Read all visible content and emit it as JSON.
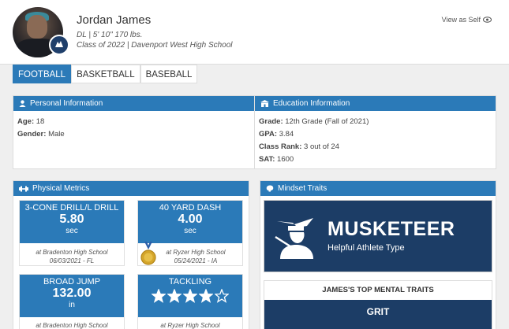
{
  "profile": {
    "name": "Jordan James",
    "position_line": "DL | 5' 10\" 170 lbs.",
    "class_line": "Class of 2022 | Davenport West High School",
    "view_as_self": "View as Self"
  },
  "tabs": [
    {
      "label": "FOOTBALL",
      "active": true
    },
    {
      "label": "BASKETBALL",
      "active": false
    },
    {
      "label": "BASEBALL",
      "active": false
    }
  ],
  "personal": {
    "title": "Personal Information",
    "age_label": "Age:",
    "age_value": "18",
    "gender_label": "Gender:",
    "gender_value": "Male"
  },
  "education": {
    "title": "Education Information",
    "grade_label": "Grade:",
    "grade_value": "12th Grade (Fall of 2021)",
    "gpa_label": "GPA:",
    "gpa_value": "3.84",
    "rank_label": "Class Rank:",
    "rank_value": "3 out of 24",
    "sat_label": "SAT:",
    "sat_value": "1600"
  },
  "physical": {
    "title": "Physical Metrics",
    "metrics": [
      {
        "title": "3-CONE DRILL/L DRILL",
        "value": "5.80",
        "unit": "sec",
        "location": "at Bradenton High School",
        "date": "06/03/2021 - FL"
      },
      {
        "title": "40 YARD DASH",
        "value": "4.00",
        "unit": "sec",
        "location": "at Ryzer High School",
        "date": "05/24/2021 - IA"
      },
      {
        "title": "BROAD JUMP",
        "value": "132.00",
        "unit": "in",
        "location": "at Bradenton High School",
        "date": ""
      },
      {
        "title": "TACKLING",
        "rating": 4,
        "rating_max": 5,
        "location": "at Ryzer High School",
        "date": ""
      }
    ]
  },
  "mindset": {
    "title": "Mindset Traits",
    "type_title": "MUSKETEER",
    "type_sub": "Helpful Athlete Type",
    "top_traits_title": "JAMES'S TOP MENTAL TRAITS",
    "top_trait": "GRIT"
  },
  "colors": {
    "accent": "#2b7ab8",
    "navy": "#1c3d66"
  },
  "icons": [
    "eye-icon",
    "user-icon",
    "school-icon",
    "dumbbell-icon",
    "brain-icon",
    "medal-icon",
    "star-icon",
    "musketeer-icon"
  ]
}
